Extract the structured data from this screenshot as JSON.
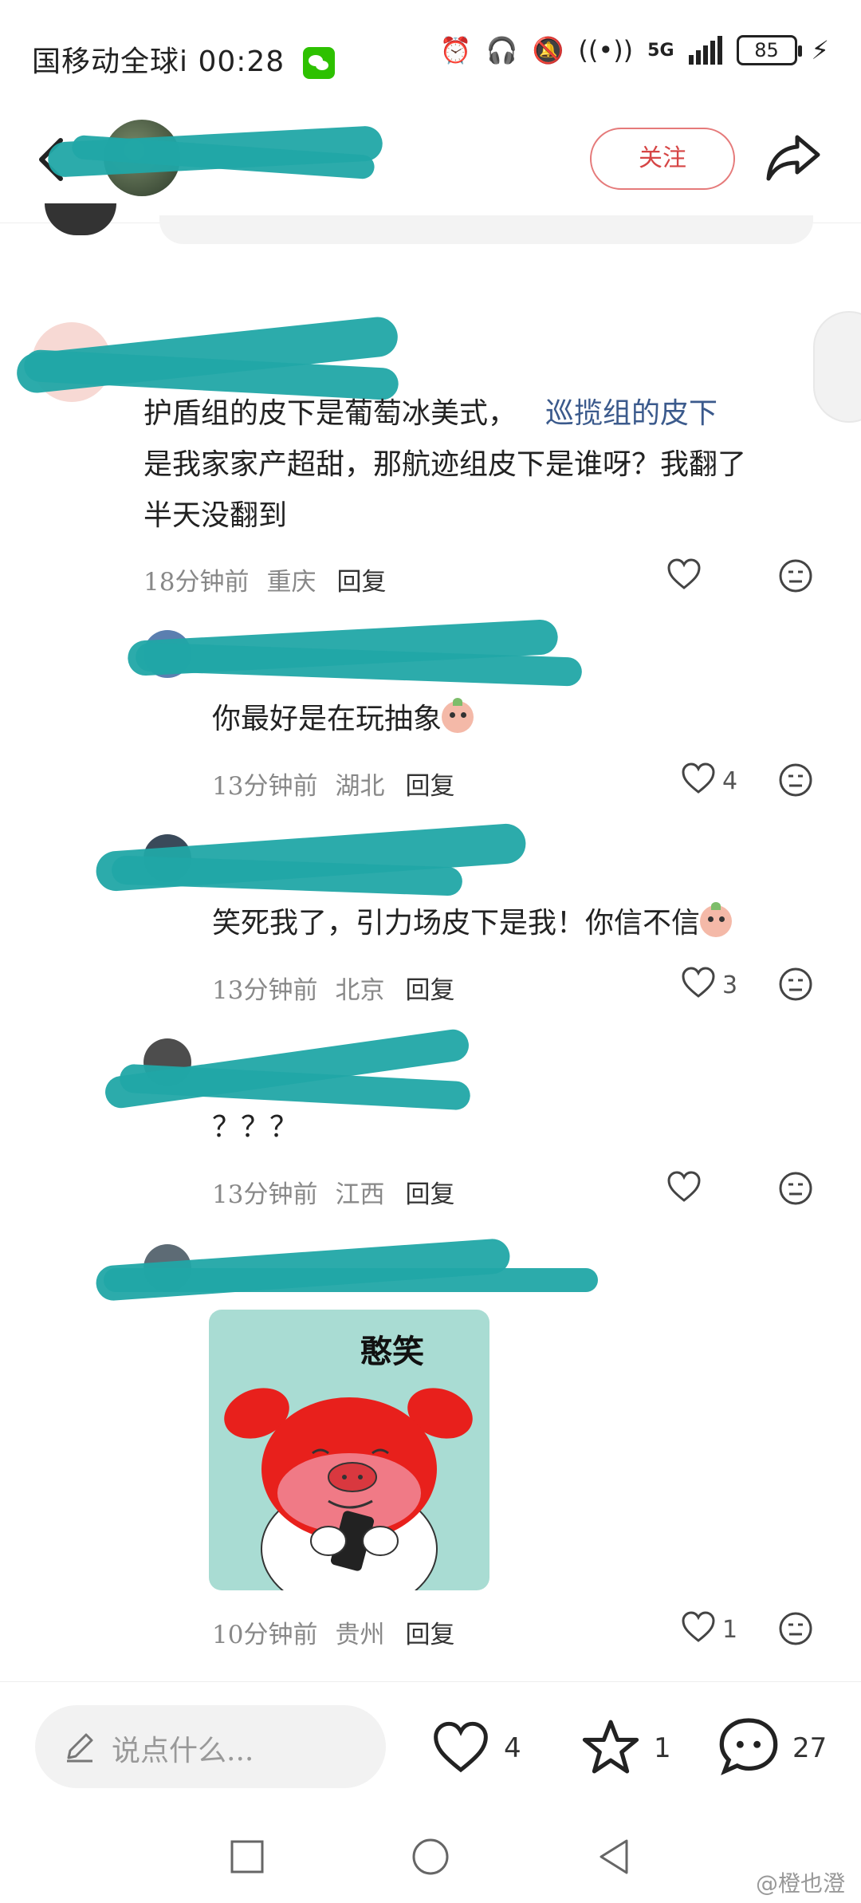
{
  "status_bar": {
    "carrier_time": "国移动全球i 00:28",
    "network": "5G",
    "battery": "85"
  },
  "header": {
    "follow_label": "关注"
  },
  "comments": [
    {
      "text_a": "护盾组的皮下是葡萄冰美式，",
      "text_link": "巡揽组的皮下",
      "text_b": "是我家家产超甜，那航迹组皮下是谁呀？我翻了",
      "text_c": "半天没翻到",
      "time": "18分钟前",
      "location": "重庆",
      "reply_label": "回复",
      "likes": ""
    }
  ],
  "replies": [
    {
      "text": "你最好是在玩抽象",
      "time": "13分钟前",
      "location": "湖北",
      "reply_label": "回复",
      "likes": "4"
    },
    {
      "text": "笑死我了，引力场皮下是我！你信不信",
      "time": "13分钟前",
      "location": "北京",
      "reply_label": "回复",
      "likes": "3"
    },
    {
      "text": "？？？",
      "time": "13分钟前",
      "location": "江西",
      "reply_label": "回复",
      "likes": ""
    },
    {
      "sticker_caption": "憨笑",
      "time": "10分钟前",
      "location": "贵州",
      "reply_label": "回复",
      "likes": "1"
    }
  ],
  "bottom_bar": {
    "placeholder": "说点什么...",
    "like_count": "4",
    "star_count": "1",
    "comment_count": "27"
  },
  "watermark": "@橙也澄"
}
